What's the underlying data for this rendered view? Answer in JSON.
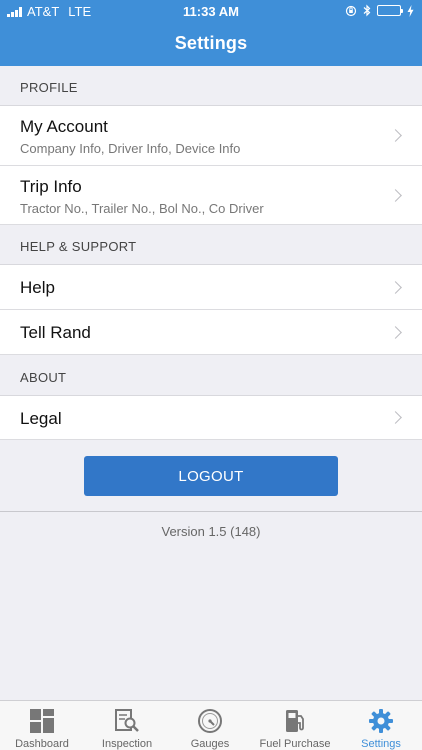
{
  "status_bar": {
    "carrier": "AT&T",
    "network": "LTE",
    "time": "11:33 AM"
  },
  "header": {
    "title": "Settings"
  },
  "sections": {
    "profile": {
      "title": "PROFILE"
    },
    "help_support": {
      "title": "HELP & SUPPORT"
    },
    "about": {
      "title": "ABOUT"
    }
  },
  "rows": {
    "my_account": {
      "label": "My Account",
      "subtitle": "Company Info, Driver Info, Device Info"
    },
    "trip_info": {
      "label": "Trip Info",
      "subtitle": "Tractor No., Trailer No., Bol No., Co Driver"
    },
    "help": {
      "label": "Help"
    },
    "tell_rand": {
      "label": "Tell Rand"
    },
    "legal": {
      "label": "Legal"
    }
  },
  "logout": {
    "label": "LOGOUT"
  },
  "version": {
    "text": "Version 1.5 (148)"
  },
  "tabs": [
    {
      "label": "Dashboard",
      "icon": "dashboard-icon"
    },
    {
      "label": "Inspection",
      "icon": "inspection-icon"
    },
    {
      "label": "Gauges",
      "icon": "gauge-icon"
    },
    {
      "label": "Fuel Purchase",
      "icon": "fuel-pump-icon"
    },
    {
      "label": "Settings",
      "icon": "gear-icon",
      "active": true
    }
  ],
  "colors": {
    "header": "#3f8fd8",
    "logout_button": "#3277c8",
    "active_tab": "#3f8fd8",
    "background": "#efeff4"
  }
}
